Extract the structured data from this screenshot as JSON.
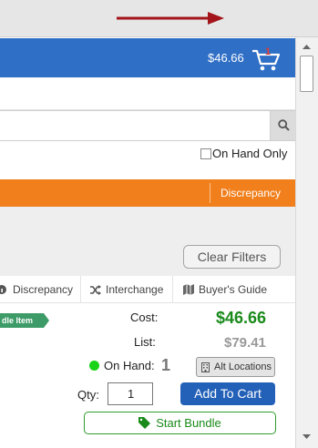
{
  "header": {
    "cart_total": "$46.66",
    "cart_count": "1"
  },
  "search": {
    "value": "",
    "placeholder": ""
  },
  "filters": {
    "on_hand_only_label": "On Hand Only",
    "on_hand_only_checked": false,
    "orange_bar_label": "Discrepancy",
    "clear_filters_label": "Clear Filters"
  },
  "tabs": [
    {
      "label": "Discrepancy",
      "icon": "info-icon"
    },
    {
      "label": "Interchange",
      "icon": "shuffle-icon"
    },
    {
      "label": "Buyer's Guide",
      "icon": "map-icon"
    }
  ],
  "product": {
    "ribbon_label": "dle Item",
    "cost_label": "Cost:",
    "cost_value": "$46.66",
    "list_label": "List:",
    "list_value": "$79.41",
    "on_hand_label": "On Hand:",
    "on_hand_value": "1",
    "alt_locations_label": "Alt Locations",
    "qty_label": "Qty:",
    "qty_value": "1",
    "add_to_cart_label": "Add To Cart",
    "start_bundle_label": "Start Bundle"
  },
  "colors": {
    "header_blue": "#2f6fc6",
    "orange": "#f07f1c",
    "cost_green": "#1a8a1a",
    "add_button_blue": "#2360b8",
    "in_stock_dot": "#19d319",
    "ribbon_green": "#3c9b67",
    "arrow_red": "#a3151b"
  }
}
